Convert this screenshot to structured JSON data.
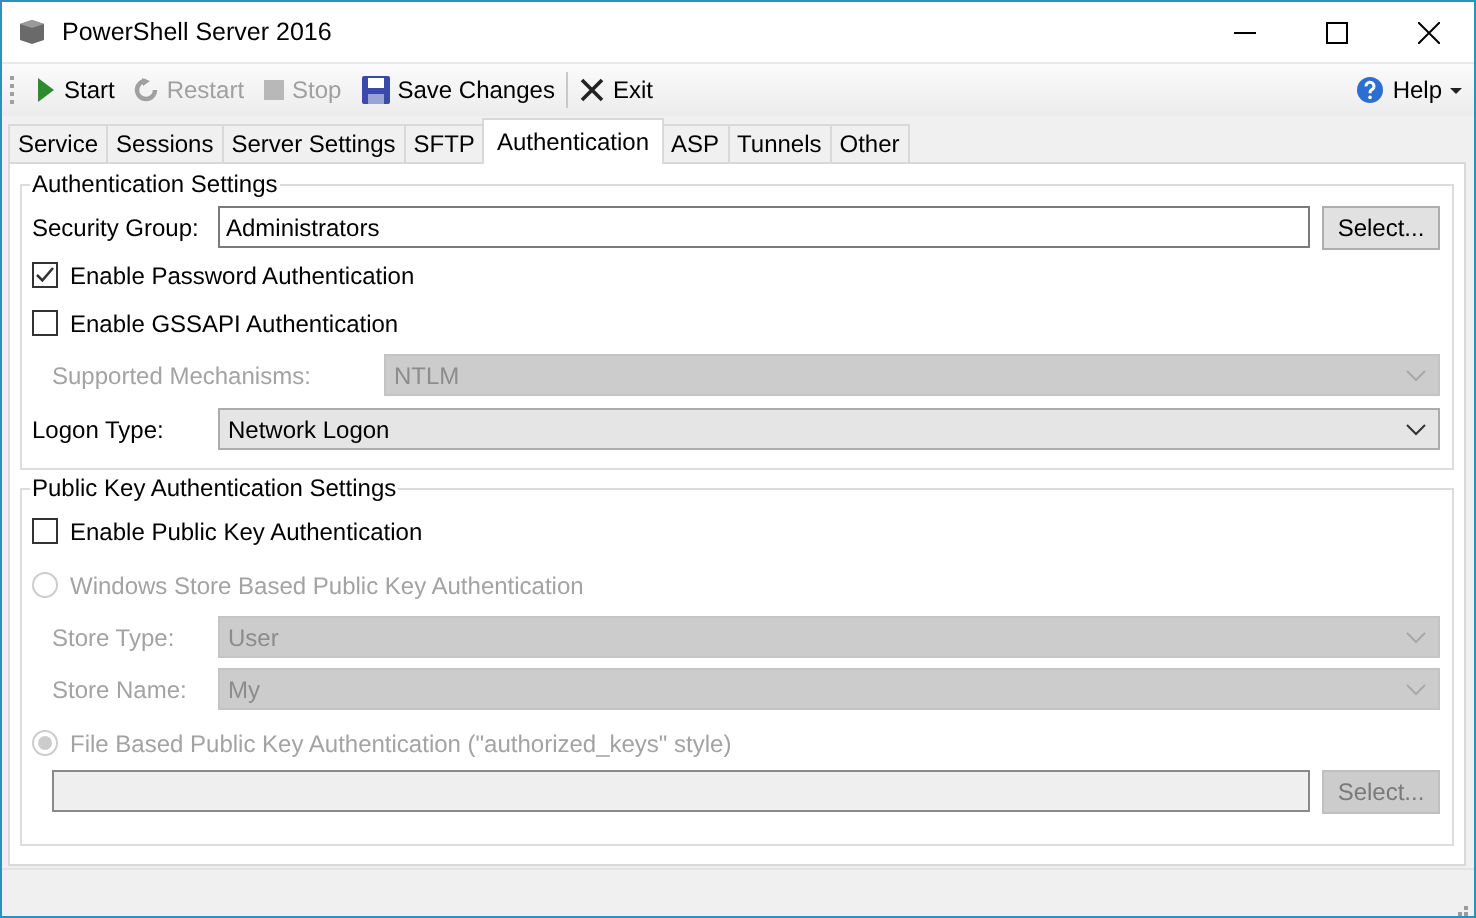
{
  "window": {
    "title": "PowerShell Server 2016"
  },
  "toolbar": {
    "items": [
      {
        "label": "Start",
        "disabled": false
      },
      {
        "label": "Restart",
        "disabled": true
      },
      {
        "label": "Stop",
        "disabled": true
      },
      {
        "label": "Save Changes",
        "disabled": false
      },
      {
        "label": "Exit",
        "disabled": false
      }
    ],
    "help": "Help"
  },
  "tabs": [
    {
      "label": "Service",
      "selected": false
    },
    {
      "label": "Sessions",
      "selected": false
    },
    {
      "label": "Server Settings",
      "selected": false
    },
    {
      "label": "SFTP",
      "selected": false
    },
    {
      "label": "Authentication",
      "selected": true
    },
    {
      "label": "ASP",
      "selected": false
    },
    {
      "label": "Tunnels",
      "selected": false
    },
    {
      "label": "Other",
      "selected": false
    }
  ],
  "groups": [
    {
      "title": "Authentication Settings",
      "rows": [
        {
          "kind": "text",
          "label": "Security Group:",
          "value": "Administrators",
          "button": "Select...",
          "disabled": false
        },
        {
          "kind": "checkbox",
          "label": "Enable Password Authentication",
          "checked": true,
          "disabled": false
        },
        {
          "kind": "checkbox",
          "label": "Enable GSSAPI Authentication",
          "checked": false,
          "disabled": false,
          "children": [
            {
              "kind": "combo",
              "label": "Supported Mechanisms:",
              "value": "NTLM",
              "disabled": true
            }
          ]
        },
        {
          "kind": "combo",
          "label": "Logon Type:",
          "value": "Network Logon",
          "disabled": false
        }
      ]
    },
    {
      "title": "Public Key Authentication Settings",
      "rows": [
        {
          "kind": "checkbox",
          "label": "Enable Public Key Authentication",
          "checked": false,
          "disabled": false
        },
        {
          "kind": "radio",
          "label": "Windows Store Based Public Key Authentication",
          "selected": false,
          "disabled": true,
          "children": [
            {
              "kind": "combo",
              "label": "Store Type:",
              "value": "User",
              "disabled": true
            },
            {
              "kind": "combo",
              "label": "Store Name:",
              "value": "My",
              "disabled": true
            }
          ]
        },
        {
          "kind": "radio",
          "label": "File Based Public Key Authentication (\"authorized_keys\" style)",
          "selected": true,
          "disabled": true,
          "children": [
            {
              "kind": "text",
              "button": "Select...",
              "disabled": true
            }
          ]
        }
      ]
    }
  ]
}
